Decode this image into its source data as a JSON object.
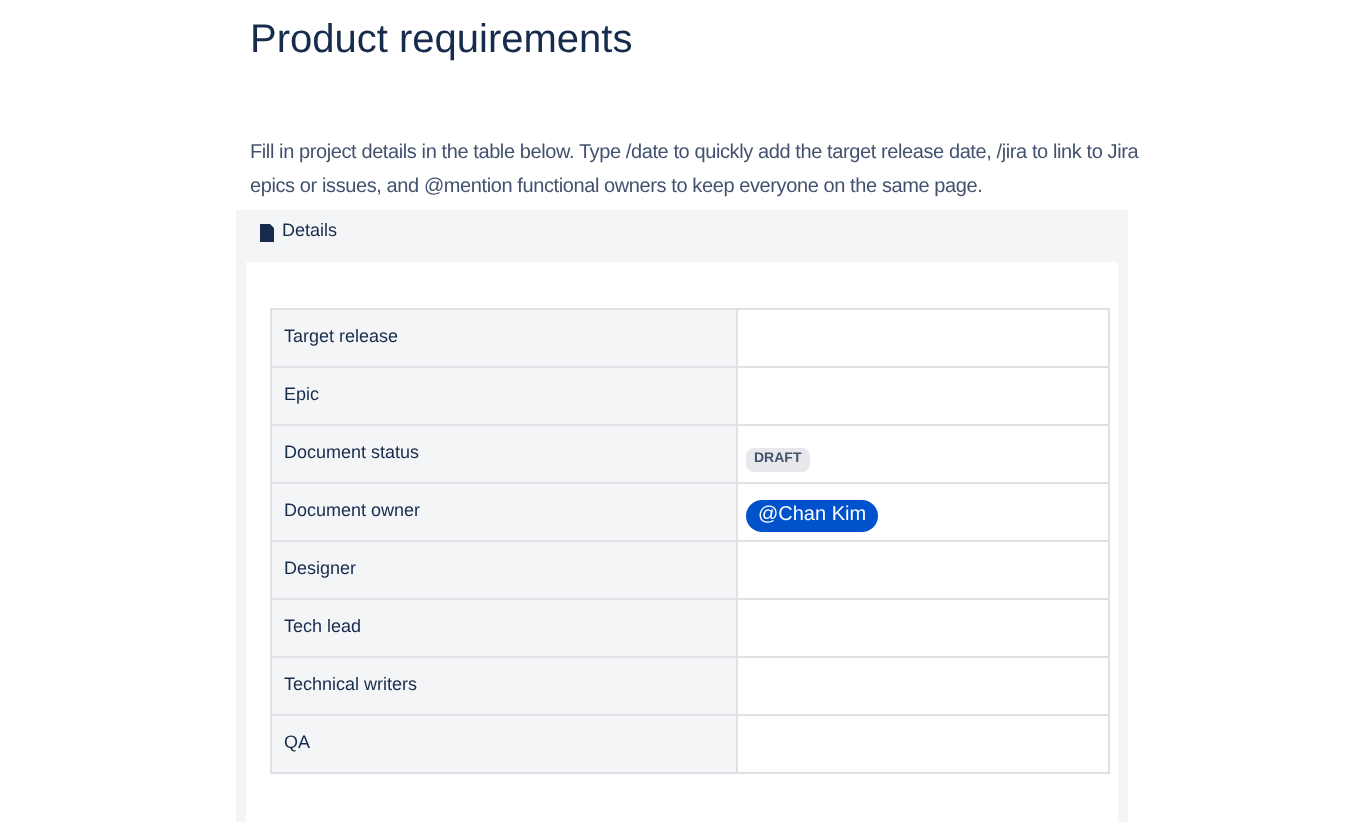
{
  "title": "Product requirements",
  "intro": "Fill in project details in the table below. Type /date to quickly add the target release date, /jira to link to Jira epics or issues, and @mention functional owners to keep everyone on the same page.",
  "panel": {
    "title": "Details"
  },
  "rows": [
    {
      "label": "Target release",
      "kind": "empty"
    },
    {
      "label": "Epic",
      "kind": "empty"
    },
    {
      "label": "Document status",
      "kind": "status",
      "value": "DRAFT"
    },
    {
      "label": "Document owner",
      "kind": "mention",
      "value": "@Chan Kim"
    },
    {
      "label": "Designer",
      "kind": "empty"
    },
    {
      "label": "Tech lead",
      "kind": "empty"
    },
    {
      "label": "Technical writers",
      "kind": "empty"
    },
    {
      "label": "QA",
      "kind": "empty"
    }
  ]
}
